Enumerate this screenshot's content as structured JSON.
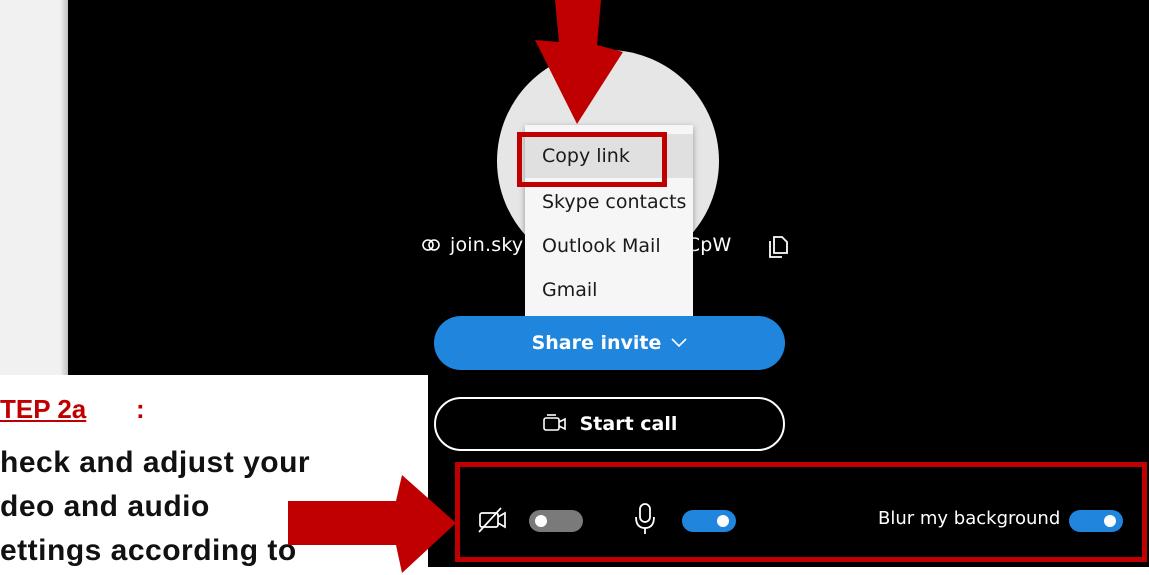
{
  "meeting": {
    "link_text": "join.skype.com/xxxxxxMCpW",
    "share_button_label": "Share invite",
    "start_call_label": "Start call"
  },
  "share_menu": {
    "items": [
      {
        "label": "Copy link"
      },
      {
        "label": "Skype contacts"
      },
      {
        "label": "Outlook Mail"
      },
      {
        "label": "Gmail"
      }
    ]
  },
  "device_settings": {
    "camera_on": false,
    "microphone_on": true,
    "blur_label": "Blur my background",
    "blur_on": true
  },
  "instructions": {
    "step_title": "TEP 2a",
    "step_colon": ":",
    "lines": [
      "heck and adjust your",
      "deo and audio",
      "ettings according to"
    ]
  },
  "colors": {
    "accent": "#1f85dd",
    "annotation_red": "#c00000",
    "background": "#000000"
  }
}
